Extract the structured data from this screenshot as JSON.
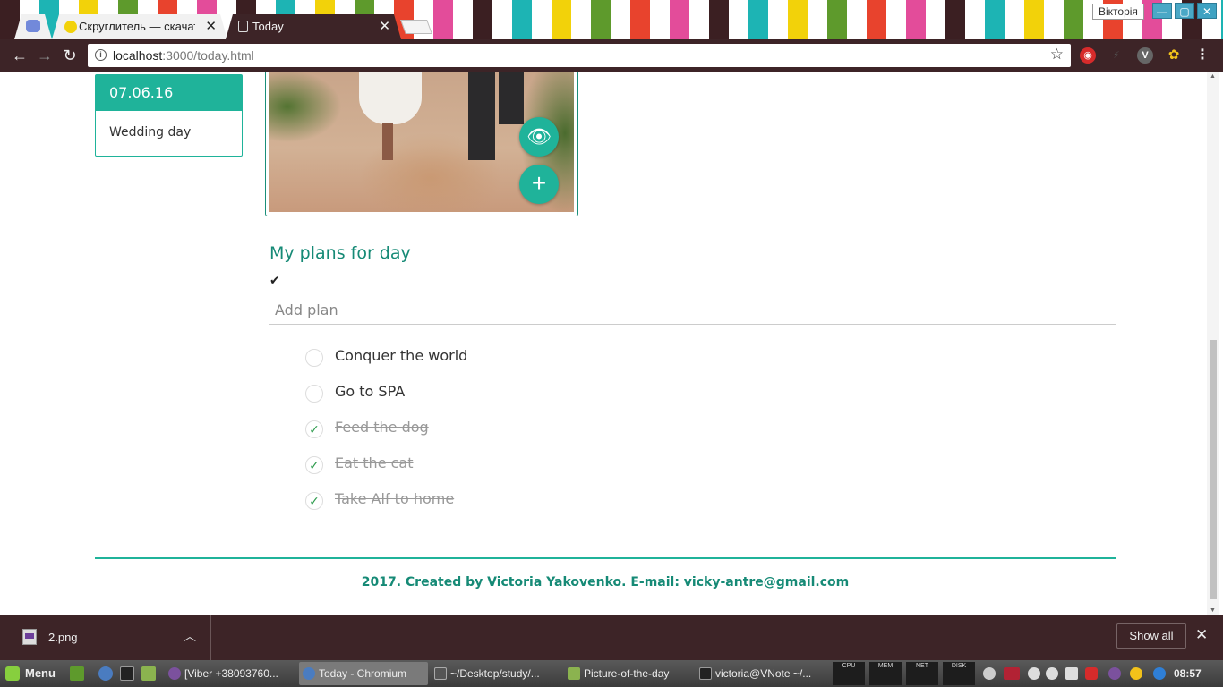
{
  "browser": {
    "tabs": [
      {
        "label": "Скруглитель — скачат",
        "active": false
      },
      {
        "label": "Today",
        "active": true
      }
    ],
    "profile": "Вікторія",
    "url_host": "localhost",
    "url_path": ":3000/today.html"
  },
  "day_card": {
    "date": "07.06.16",
    "title": "Wedding day"
  },
  "plans_section": {
    "title": "My plans for day",
    "toggle_all": "✔",
    "add_placeholder": "Add plan",
    "items": [
      {
        "text": "Conquer the world",
        "done": false
      },
      {
        "text": "Go to SPA",
        "done": false
      },
      {
        "text": "Feed the dog",
        "done": true
      },
      {
        "text": "Eat the cat",
        "done": true
      },
      {
        "text": "Take Alf to home",
        "done": true
      }
    ]
  },
  "footer": {
    "text": "2017. Created by Victoria Yakovenko. E-mail: vicky-antre@gmail.com"
  },
  "download_bar": {
    "file_name": "2.png",
    "show_all": "Show all"
  },
  "taskbar": {
    "menu_label": "Menu",
    "tasks": [
      {
        "label": "[Viber +38093760...",
        "active": false
      },
      {
        "label": "Today - Chromium",
        "active": true
      },
      {
        "label": "~/Desktop/study/...",
        "active": false
      },
      {
        "label": "Picture-of-the-day",
        "active": false
      },
      {
        "label": "victoria@VNote ~/...",
        "active": false
      }
    ],
    "monitors": [
      "CPU",
      "MEM",
      "NET",
      "DISK"
    ],
    "clock": "08:57"
  },
  "colors": {
    "accent": "#1fb39a",
    "accent_dark": "#168a76",
    "chrome_dark": "#3d2427"
  }
}
